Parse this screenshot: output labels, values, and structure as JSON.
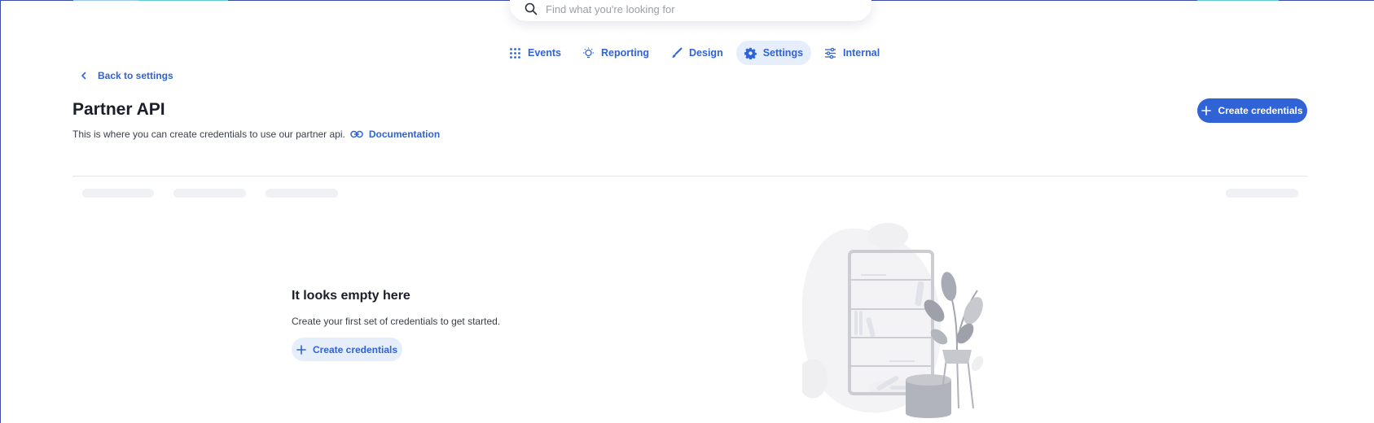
{
  "search": {
    "placeholder": "Find what you're looking for",
    "icon": "search-icon"
  },
  "nav": {
    "items": [
      {
        "label": "Events",
        "icon": "grid-icon",
        "active": false
      },
      {
        "label": "Reporting",
        "icon": "lightbulb-icon",
        "active": false
      },
      {
        "label": "Design",
        "icon": "brush-icon",
        "active": false
      },
      {
        "label": "Settings",
        "icon": "gear-icon",
        "active": true
      },
      {
        "label": "Internal",
        "icon": "sliders-icon",
        "active": false
      }
    ]
  },
  "breadcrumb": {
    "back_label": "Back to settings"
  },
  "header": {
    "title": "Partner API",
    "description": "This is where you can create credentials to use our partner api.",
    "doc_link_label": "Documentation",
    "create_button_label": "Create credentials"
  },
  "empty_state": {
    "title": "It looks empty here",
    "description": "Create your first set of credentials to get started.",
    "button_label": "Create credentials"
  },
  "colors": {
    "accent": "#2f63d6",
    "accent_light": "#e6eefc",
    "text": "#1b1e28"
  }
}
